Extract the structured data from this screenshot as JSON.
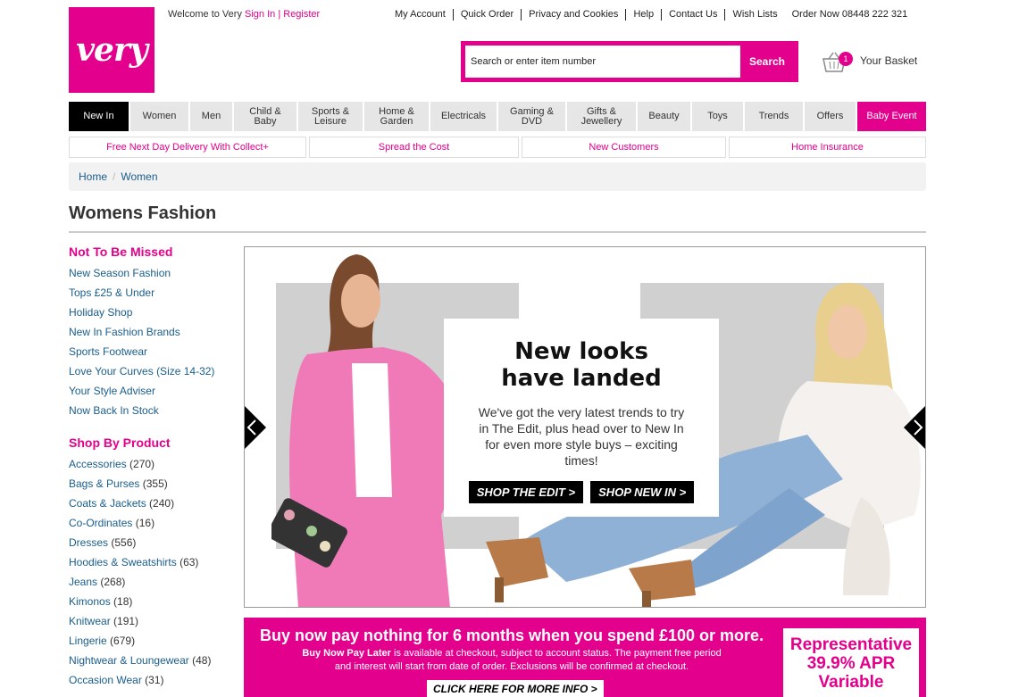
{
  "brand": {
    "logo_text": "very",
    "accent": "#e3008c"
  },
  "welcome": {
    "text": "Welcome to Very",
    "signin": "Sign In",
    "sep": "|",
    "register": "Register"
  },
  "toplinks": [
    "My Account",
    "Quick Order",
    "Privacy and Cookies",
    "Help",
    "Contact Us",
    "Wish Lists"
  ],
  "phone": "Order Now 08448 222 321",
  "search": {
    "placeholder": "Search or enter item number",
    "button": "Search"
  },
  "basket": {
    "count": "1",
    "label": "Your Basket"
  },
  "nav": [
    {
      "label": "New In",
      "w": 67
    },
    {
      "label": "Women",
      "w": 65
    },
    {
      "label": "Men",
      "w": 47
    },
    {
      "label": "Child & Baby",
      "w": 70
    },
    {
      "label": "Sports & Leisure",
      "w": 72
    },
    {
      "label": "Home & Garden",
      "w": 72
    },
    {
      "label": "Electricals",
      "w": 74
    },
    {
      "label": "Gaming & DVD",
      "w": 75
    },
    {
      "label": "Gifts & Jewellery",
      "w": 77
    },
    {
      "label": "Beauty",
      "w": 59
    },
    {
      "label": "Toys",
      "w": 57
    },
    {
      "label": "Trends",
      "w": 65
    },
    {
      "label": "Offers",
      "w": 57
    },
    {
      "label": "Baby Event",
      "w": 77
    }
  ],
  "promo": [
    {
      "label": "Free Next Day Delivery With Collect+",
      "w": 266
    },
    {
      "label": "Spread the Cost",
      "w": 235
    },
    {
      "label": "New Customers",
      "w": 229
    },
    {
      "label": "Home Insurance",
      "w": 221
    }
  ],
  "breadcrumb": {
    "home": "Home",
    "sep": "/",
    "current": "Women"
  },
  "page_title": "Womens Fashion",
  "sidebar": {
    "section1_title": "Not To Be Missed",
    "section1": [
      "New Season Fashion",
      "Tops £25 & Under",
      "Holiday Shop",
      "New In Fashion Brands",
      "Sports Footwear",
      "Love Your Curves (Size 14-32)",
      "Your Style Adviser",
      "Now Back In Stock"
    ],
    "section2_title": "Shop By Product",
    "section2": [
      {
        "name": "Accessories",
        "count": "(270)"
      },
      {
        "name": "Bags & Purses",
        "count": "(355)"
      },
      {
        "name": "Coats & Jackets",
        "count": "(240)"
      },
      {
        "name": "Co-Ordinates",
        "count": "(16)"
      },
      {
        "name": "Dresses",
        "count": "(556)"
      },
      {
        "name": "Hoodies & Sweatshirts",
        "count": "(63)"
      },
      {
        "name": "Jeans",
        "count": "(268)"
      },
      {
        "name": "Kimonos",
        "count": "(18)"
      },
      {
        "name": "Knitwear",
        "count": "(191)"
      },
      {
        "name": "Lingerie",
        "count": "(679)"
      },
      {
        "name": "Nightwear & Loungewear",
        "count": "(48)"
      },
      {
        "name": "Occasion Wear",
        "count": "(31)"
      }
    ]
  },
  "hero": {
    "headline_line1": "New looks",
    "headline_line2": "have landed",
    "body": "We've got the very latest trends to try in The Edit, plus head over to New In for even more style buys – exciting times!",
    "btn_edit": "SHOP THE EDIT >",
    "btn_newin": "SHOP NEW IN >"
  },
  "finance": {
    "headline": "Buy now pay nothing for 6 months when you spend £100 or more.",
    "bold": "Buy Now Pay Later",
    "body1": " is available at checkout, subject to account status. The payment free period",
    "body2": "and interest will start from date of order. Exclusions will be confirmed at checkout.",
    "cta": "CLICK HERE FOR MORE INFO >",
    "apr_line1": "Representative",
    "apr_line2": "39.9% APR",
    "apr_line3": "Variable"
  }
}
